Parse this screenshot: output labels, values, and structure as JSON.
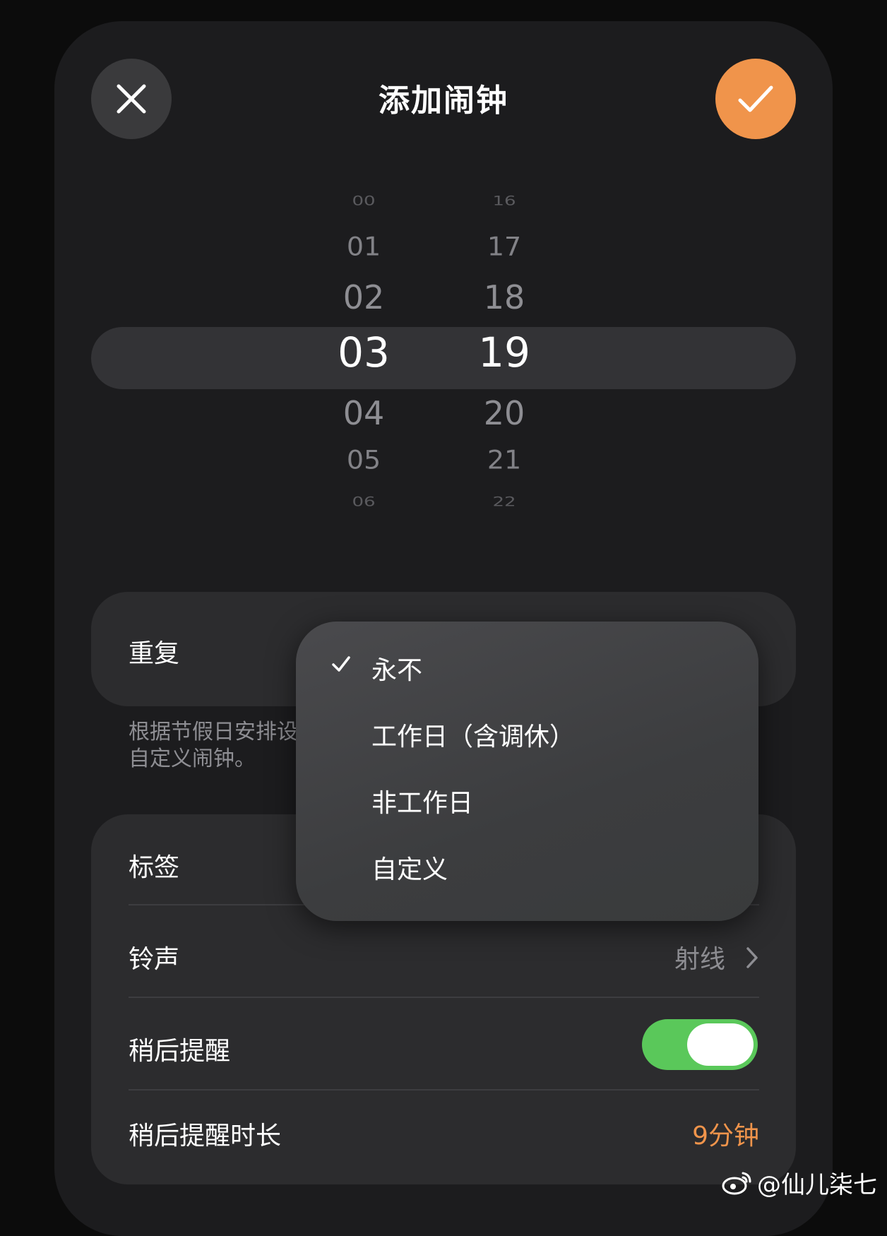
{
  "header": {
    "title": "添加闹钟",
    "close_icon": "close-icon",
    "confirm_icon": "checkmark-icon",
    "accent_color": "#f0944b"
  },
  "picker": {
    "hours": [
      "00",
      "01",
      "02",
      "03",
      "04",
      "05",
      "06"
    ],
    "minutes": [
      "16",
      "17",
      "18",
      "19",
      "20",
      "21",
      "22"
    ],
    "selected_hour": "03",
    "selected_minute": "19"
  },
  "repeat": {
    "label": "重复",
    "note": "根据节假日安排设\n自定义闹钟。"
  },
  "menu": {
    "items": [
      {
        "label": "永不",
        "checked": true
      },
      {
        "label": "工作日（含调休）",
        "checked": false
      },
      {
        "label": "非工作日",
        "checked": false
      },
      {
        "label": "自定义",
        "checked": false
      }
    ]
  },
  "settings": {
    "label_row": {
      "label": "标签"
    },
    "ringtone_row": {
      "label": "铃声",
      "value": "射线"
    },
    "snooze_row": {
      "label": "稍后提醒",
      "enabled": true,
      "toggle_color": "#5ac85a"
    },
    "snooze_duration_row": {
      "label": "稍后提醒时长",
      "value": "9分钟"
    }
  },
  "watermark": {
    "text": "@仙儿柒七",
    "icon": "weibo-icon"
  }
}
